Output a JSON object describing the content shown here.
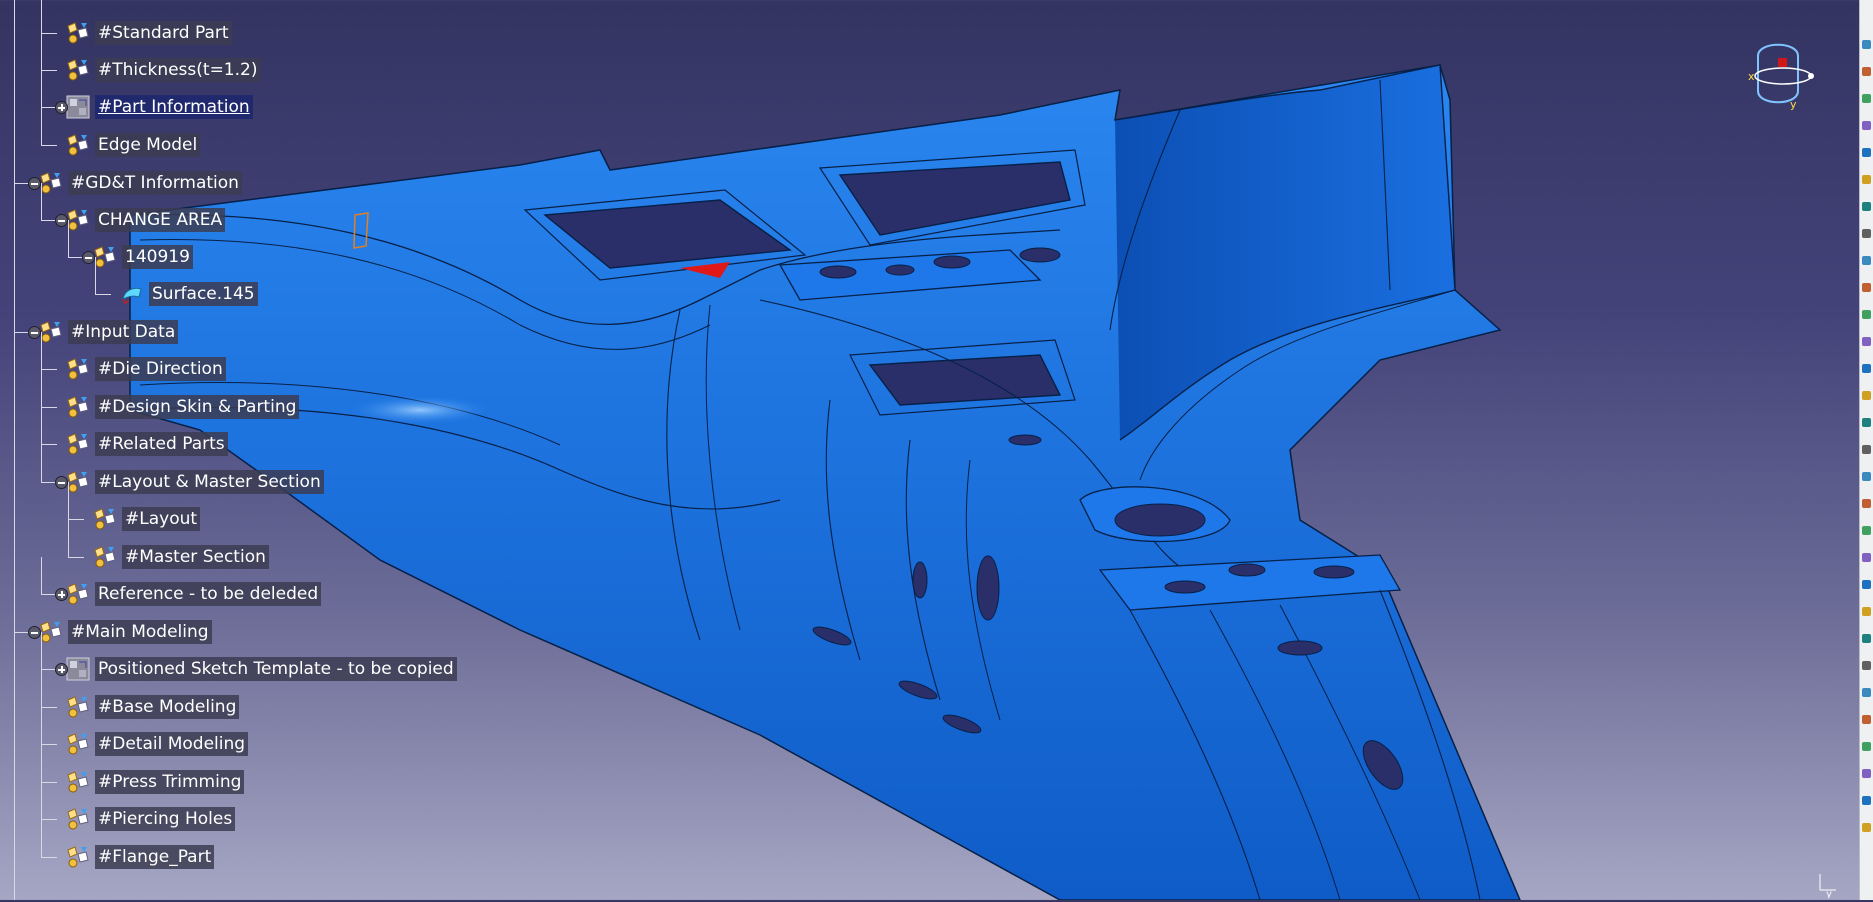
{
  "spec_tree": {
    "items": [
      {
        "label": "#Standard Part",
        "icon": "part-body-icon"
      },
      {
        "label": "#Thickness(t=1.2)",
        "icon": "part-body-icon"
      },
      {
        "label": "#Part Information",
        "icon": "geometric-set-icon"
      },
      {
        "label": "Edge Model",
        "icon": "part-body-icon"
      },
      {
        "label": "#GD&T Information",
        "icon": "part-body-icon"
      },
      {
        "label": "CHANGE AREA",
        "icon": "part-body-icon"
      },
      {
        "label": "140919",
        "icon": "part-body-icon"
      },
      {
        "label": "Surface.145",
        "icon": "surface-icon"
      },
      {
        "label": "#Input Data",
        "icon": "part-body-icon"
      },
      {
        "label": "#Die Direction",
        "icon": "part-body-icon"
      },
      {
        "label": "#Design Skin & Parting",
        "icon": "part-body-icon"
      },
      {
        "label": "#Related Parts",
        "icon": "part-body-icon"
      },
      {
        "label": "#Layout & Master Section",
        "icon": "part-body-icon"
      },
      {
        "label": "#Layout",
        "icon": "part-body-icon"
      },
      {
        "label": "#Master Section",
        "icon": "part-body-icon"
      },
      {
        "label": "Reference - to be deleded",
        "icon": "part-body-icon"
      },
      {
        "label": "#Main Modeling",
        "icon": "part-body-icon"
      },
      {
        "label": "Positioned Sketch Template - to be copied",
        "icon": "geometric-set-icon"
      },
      {
        "label": "#Base Modeling",
        "icon": "part-body-icon"
      },
      {
        "label": "#Detail Modeling",
        "icon": "part-body-icon"
      },
      {
        "label": "#Press Trimming",
        "icon": "part-body-icon"
      },
      {
        "label": "#Piercing Holes",
        "icon": "part-body-icon"
      },
      {
        "label": "#Flange_Part",
        "icon": "part-body-icon"
      }
    ]
  },
  "colors": {
    "model_blue": "#1464d8",
    "model_edge": "#062048",
    "background_top": "#343462",
    "background_bottom": "#a6a6c4",
    "tree_label_bg": "#3c3c52"
  },
  "compass": {
    "x_label": "x",
    "y_label": "y"
  },
  "mini_axis": {
    "y_label": "y"
  }
}
